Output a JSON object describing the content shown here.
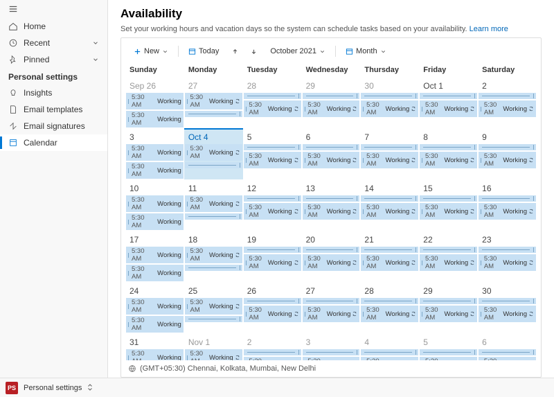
{
  "nav": {
    "home": "Home",
    "recent": "Recent",
    "pinned": "Pinned"
  },
  "section": "Personal settings",
  "subnav": {
    "insights": "Insights",
    "templates": "Email templates",
    "signatures": "Email signatures",
    "calendar": "Calendar"
  },
  "page": {
    "title": "Availability",
    "desc": "Set your working hours and vacation days so the system can schedule tasks based on your availability.",
    "learn": "Learn more"
  },
  "toolbar": {
    "new": "New",
    "today": "Today",
    "range": "October 2021",
    "view": "Month"
  },
  "days": [
    "Sunday",
    "Monday",
    "Tuesday",
    "Wednesday",
    "Thursday",
    "Friday",
    "Saturday"
  ],
  "weeks": [
    [
      {
        "d": "Sep 26",
        "m": true
      },
      {
        "d": "27",
        "m": true
      },
      {
        "d": "28",
        "m": true
      },
      {
        "d": "29",
        "m": true
      },
      {
        "d": "30",
        "m": true
      },
      {
        "d": "Oct 1"
      },
      {
        "d": "2"
      }
    ],
    [
      {
        "d": "3"
      },
      {
        "d": "Oct 4",
        "today": true
      },
      {
        "d": "5"
      },
      {
        "d": "6"
      },
      {
        "d": "7"
      },
      {
        "d": "8"
      },
      {
        "d": "9"
      }
    ],
    [
      {
        "d": "10"
      },
      {
        "d": "11"
      },
      {
        "d": "12"
      },
      {
        "d": "13"
      },
      {
        "d": "14"
      },
      {
        "d": "15"
      },
      {
        "d": "16"
      }
    ],
    [
      {
        "d": "17"
      },
      {
        "d": "18"
      },
      {
        "d": "19"
      },
      {
        "d": "20"
      },
      {
        "d": "21"
      },
      {
        "d": "22"
      },
      {
        "d": "23"
      }
    ],
    [
      {
        "d": "24"
      },
      {
        "d": "25"
      },
      {
        "d": "26"
      },
      {
        "d": "27"
      },
      {
        "d": "28"
      },
      {
        "d": "29"
      },
      {
        "d": "30"
      }
    ],
    [
      {
        "d": "31"
      },
      {
        "d": "Nov 1",
        "m": true
      },
      {
        "d": "2",
        "m": true
      },
      {
        "d": "3",
        "m": true
      },
      {
        "d": "4",
        "m": true
      },
      {
        "d": "5",
        "m": true
      },
      {
        "d": "6",
        "m": true
      }
    ]
  ],
  "evt": {
    "time": "5:30 AM",
    "label": "Working"
  },
  "tz": "(GMT+05:30) Chennai, Kolkata, Mumbai, New Delhi",
  "footer": {
    "badge": "PS",
    "label": "Personal settings"
  }
}
